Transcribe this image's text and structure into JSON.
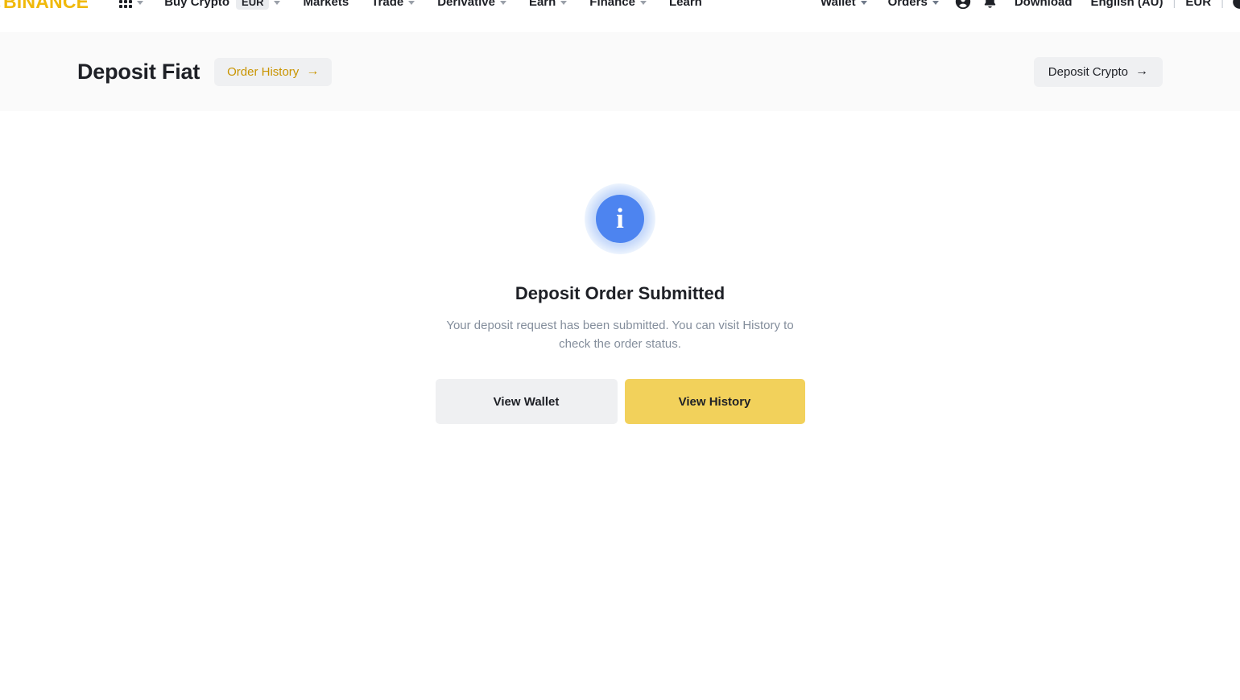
{
  "navbar": {
    "logo_text": "BINANCE",
    "apps_icon": "grid-apps-icon",
    "items": [
      {
        "label": "Buy Crypto",
        "badge": "EUR",
        "caret": true
      },
      {
        "label": "Markets",
        "caret": false
      },
      {
        "label": "Trade",
        "caret": true
      },
      {
        "label": "Derivative",
        "caret": true
      },
      {
        "label": "Earn",
        "caret": true
      },
      {
        "label": "Finance",
        "caret": true
      },
      {
        "label": "Learn",
        "caret": false
      }
    ],
    "right_items": [
      {
        "label": "Wallet",
        "caret": true
      },
      {
        "label": "Orders",
        "caret": true
      }
    ],
    "account_icon": "user-account-icon",
    "notification_icon": "bell-icon",
    "download_label": "Download",
    "language_label": "English (AU)",
    "currency_label": "EUR",
    "theme_icon": "theme-toggle-icon",
    "divider": "|"
  },
  "page_header": {
    "title": "Deposit Fiat",
    "order_history_label": "Order History",
    "deposit_crypto_label": "Deposit Crypto",
    "arrow_glyph": "→"
  },
  "result": {
    "status_icon": "info-circle-icon",
    "info_glyph": "i",
    "title": "Deposit Order Submitted",
    "description": "Your deposit request has been submitted. You can visit History to check the order status.",
    "primary_button": "View History",
    "secondary_button": "View Wallet"
  },
  "colors": {
    "brand_yellow": "#f0b90b",
    "button_yellow": "#f2d15b",
    "gold_text": "#c99400",
    "info_blue": "#4d84f0",
    "text_dark": "#1e2026",
    "text_muted": "#848e9c",
    "surface_gray": "#eff0f2",
    "band_gray": "#fafafa"
  }
}
